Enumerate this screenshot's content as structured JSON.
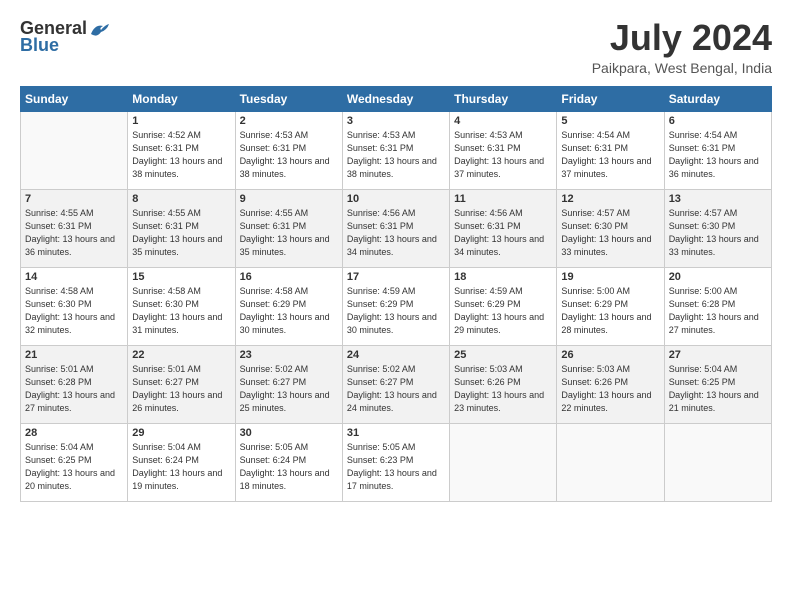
{
  "header": {
    "logo_general": "General",
    "logo_blue": "Blue",
    "month": "July 2024",
    "location": "Paikpara, West Bengal, India"
  },
  "weekdays": [
    "Sunday",
    "Monday",
    "Tuesday",
    "Wednesday",
    "Thursday",
    "Friday",
    "Saturday"
  ],
  "weeks": [
    [
      {
        "day": "",
        "sunrise": "",
        "sunset": "",
        "daylight": ""
      },
      {
        "day": "1",
        "sunrise": "Sunrise: 4:52 AM",
        "sunset": "Sunset: 6:31 PM",
        "daylight": "Daylight: 13 hours and 38 minutes."
      },
      {
        "day": "2",
        "sunrise": "Sunrise: 4:53 AM",
        "sunset": "Sunset: 6:31 PM",
        "daylight": "Daylight: 13 hours and 38 minutes."
      },
      {
        "day": "3",
        "sunrise": "Sunrise: 4:53 AM",
        "sunset": "Sunset: 6:31 PM",
        "daylight": "Daylight: 13 hours and 38 minutes."
      },
      {
        "day": "4",
        "sunrise": "Sunrise: 4:53 AM",
        "sunset": "Sunset: 6:31 PM",
        "daylight": "Daylight: 13 hours and 37 minutes."
      },
      {
        "day": "5",
        "sunrise": "Sunrise: 4:54 AM",
        "sunset": "Sunset: 6:31 PM",
        "daylight": "Daylight: 13 hours and 37 minutes."
      },
      {
        "day": "6",
        "sunrise": "Sunrise: 4:54 AM",
        "sunset": "Sunset: 6:31 PM",
        "daylight": "Daylight: 13 hours and 36 minutes."
      }
    ],
    [
      {
        "day": "7",
        "sunrise": "Sunrise: 4:55 AM",
        "sunset": "Sunset: 6:31 PM",
        "daylight": "Daylight: 13 hours and 36 minutes."
      },
      {
        "day": "8",
        "sunrise": "Sunrise: 4:55 AM",
        "sunset": "Sunset: 6:31 PM",
        "daylight": "Daylight: 13 hours and 35 minutes."
      },
      {
        "day": "9",
        "sunrise": "Sunrise: 4:55 AM",
        "sunset": "Sunset: 6:31 PM",
        "daylight": "Daylight: 13 hours and 35 minutes."
      },
      {
        "day": "10",
        "sunrise": "Sunrise: 4:56 AM",
        "sunset": "Sunset: 6:31 PM",
        "daylight": "Daylight: 13 hours and 34 minutes."
      },
      {
        "day": "11",
        "sunrise": "Sunrise: 4:56 AM",
        "sunset": "Sunset: 6:31 PM",
        "daylight": "Daylight: 13 hours and 34 minutes."
      },
      {
        "day": "12",
        "sunrise": "Sunrise: 4:57 AM",
        "sunset": "Sunset: 6:30 PM",
        "daylight": "Daylight: 13 hours and 33 minutes."
      },
      {
        "day": "13",
        "sunrise": "Sunrise: 4:57 AM",
        "sunset": "Sunset: 6:30 PM",
        "daylight": "Daylight: 13 hours and 33 minutes."
      }
    ],
    [
      {
        "day": "14",
        "sunrise": "Sunrise: 4:58 AM",
        "sunset": "Sunset: 6:30 PM",
        "daylight": "Daylight: 13 hours and 32 minutes."
      },
      {
        "day": "15",
        "sunrise": "Sunrise: 4:58 AM",
        "sunset": "Sunset: 6:30 PM",
        "daylight": "Daylight: 13 hours and 31 minutes."
      },
      {
        "day": "16",
        "sunrise": "Sunrise: 4:58 AM",
        "sunset": "Sunset: 6:29 PM",
        "daylight": "Daylight: 13 hours and 30 minutes."
      },
      {
        "day": "17",
        "sunrise": "Sunrise: 4:59 AM",
        "sunset": "Sunset: 6:29 PM",
        "daylight": "Daylight: 13 hours and 30 minutes."
      },
      {
        "day": "18",
        "sunrise": "Sunrise: 4:59 AM",
        "sunset": "Sunset: 6:29 PM",
        "daylight": "Daylight: 13 hours and 29 minutes."
      },
      {
        "day": "19",
        "sunrise": "Sunrise: 5:00 AM",
        "sunset": "Sunset: 6:29 PM",
        "daylight": "Daylight: 13 hours and 28 minutes."
      },
      {
        "day": "20",
        "sunrise": "Sunrise: 5:00 AM",
        "sunset": "Sunset: 6:28 PM",
        "daylight": "Daylight: 13 hours and 27 minutes."
      }
    ],
    [
      {
        "day": "21",
        "sunrise": "Sunrise: 5:01 AM",
        "sunset": "Sunset: 6:28 PM",
        "daylight": "Daylight: 13 hours and 27 minutes."
      },
      {
        "day": "22",
        "sunrise": "Sunrise: 5:01 AM",
        "sunset": "Sunset: 6:27 PM",
        "daylight": "Daylight: 13 hours and 26 minutes."
      },
      {
        "day": "23",
        "sunrise": "Sunrise: 5:02 AM",
        "sunset": "Sunset: 6:27 PM",
        "daylight": "Daylight: 13 hours and 25 minutes."
      },
      {
        "day": "24",
        "sunrise": "Sunrise: 5:02 AM",
        "sunset": "Sunset: 6:27 PM",
        "daylight": "Daylight: 13 hours and 24 minutes."
      },
      {
        "day": "25",
        "sunrise": "Sunrise: 5:03 AM",
        "sunset": "Sunset: 6:26 PM",
        "daylight": "Daylight: 13 hours and 23 minutes."
      },
      {
        "day": "26",
        "sunrise": "Sunrise: 5:03 AM",
        "sunset": "Sunset: 6:26 PM",
        "daylight": "Daylight: 13 hours and 22 minutes."
      },
      {
        "day": "27",
        "sunrise": "Sunrise: 5:04 AM",
        "sunset": "Sunset: 6:25 PM",
        "daylight": "Daylight: 13 hours and 21 minutes."
      }
    ],
    [
      {
        "day": "28",
        "sunrise": "Sunrise: 5:04 AM",
        "sunset": "Sunset: 6:25 PM",
        "daylight": "Daylight: 13 hours and 20 minutes."
      },
      {
        "day": "29",
        "sunrise": "Sunrise: 5:04 AM",
        "sunset": "Sunset: 6:24 PM",
        "daylight": "Daylight: 13 hours and 19 minutes."
      },
      {
        "day": "30",
        "sunrise": "Sunrise: 5:05 AM",
        "sunset": "Sunset: 6:24 PM",
        "daylight": "Daylight: 13 hours and 18 minutes."
      },
      {
        "day": "31",
        "sunrise": "Sunrise: 5:05 AM",
        "sunset": "Sunset: 6:23 PM",
        "daylight": "Daylight: 13 hours and 17 minutes."
      },
      {
        "day": "",
        "sunrise": "",
        "sunset": "",
        "daylight": ""
      },
      {
        "day": "",
        "sunrise": "",
        "sunset": "",
        "daylight": ""
      },
      {
        "day": "",
        "sunrise": "",
        "sunset": "",
        "daylight": ""
      }
    ]
  ]
}
